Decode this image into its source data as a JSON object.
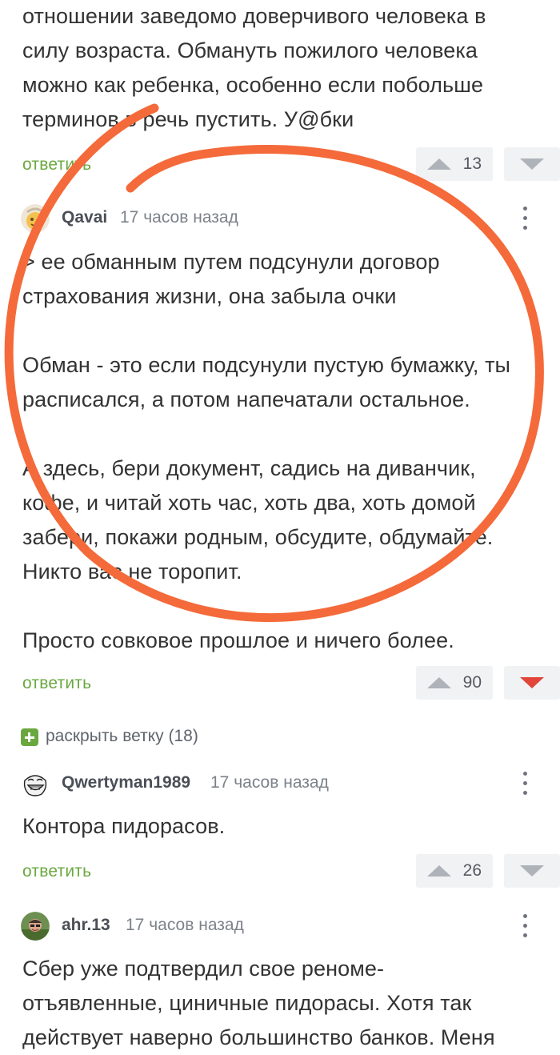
{
  "colors": {
    "accent_green": "#6aa83f",
    "downvote_active": "#e2453a",
    "annotation_orange": "#f46a3a"
  },
  "top_comment": {
    "lines": [
      "отношении заведомо доверчивого человека в",
      "силу возраста. Обмануть пожилого человека",
      "можно как ребенка, особенно если побольше",
      "терминов в речь пустить. У@бки"
    ],
    "reply_label": "ответить",
    "rating": "13"
  },
  "comment_qavai": {
    "avatar_icon": "avatar-icon",
    "username": "Qavai",
    "time": "17 часов назад",
    "paragraphs": [
      [
        "> ее обманным путем подсунули договор",
        "страхования жизни, она забыла очки"
      ],
      [
        "Обман - это если подсунули пустую бумажку, ты",
        "расписался, а потом напечатали остальное."
      ],
      [
        "А здесь, бери документ, садись на диванчик,",
        "кофе, и читай хоть час, хоть два, хоть домой",
        "забери, покажи родным, обсудите, обдумайте.",
        "Никто вас не торопит."
      ],
      [
        "Просто совковое прошлое и ничего более."
      ]
    ],
    "reply_label": "ответить",
    "rating": "90"
  },
  "expand_branch": {
    "label": "раскрыть ветку (18)"
  },
  "comment_qwertyman": {
    "username": "Qwertyman1989",
    "time": "17 часов назад",
    "text": "Контора пидорасов.",
    "reply_label": "ответить",
    "rating": "26"
  },
  "comment_ahr": {
    "username": "ahr.13",
    "time": "17 часов назад",
    "lines": [
      "Сбер уже подтвердил свое реноме-",
      "отъявленные, циничные пидорасы. Хотя так",
      "действует наверно большинство банков. Меня"
    ]
  }
}
